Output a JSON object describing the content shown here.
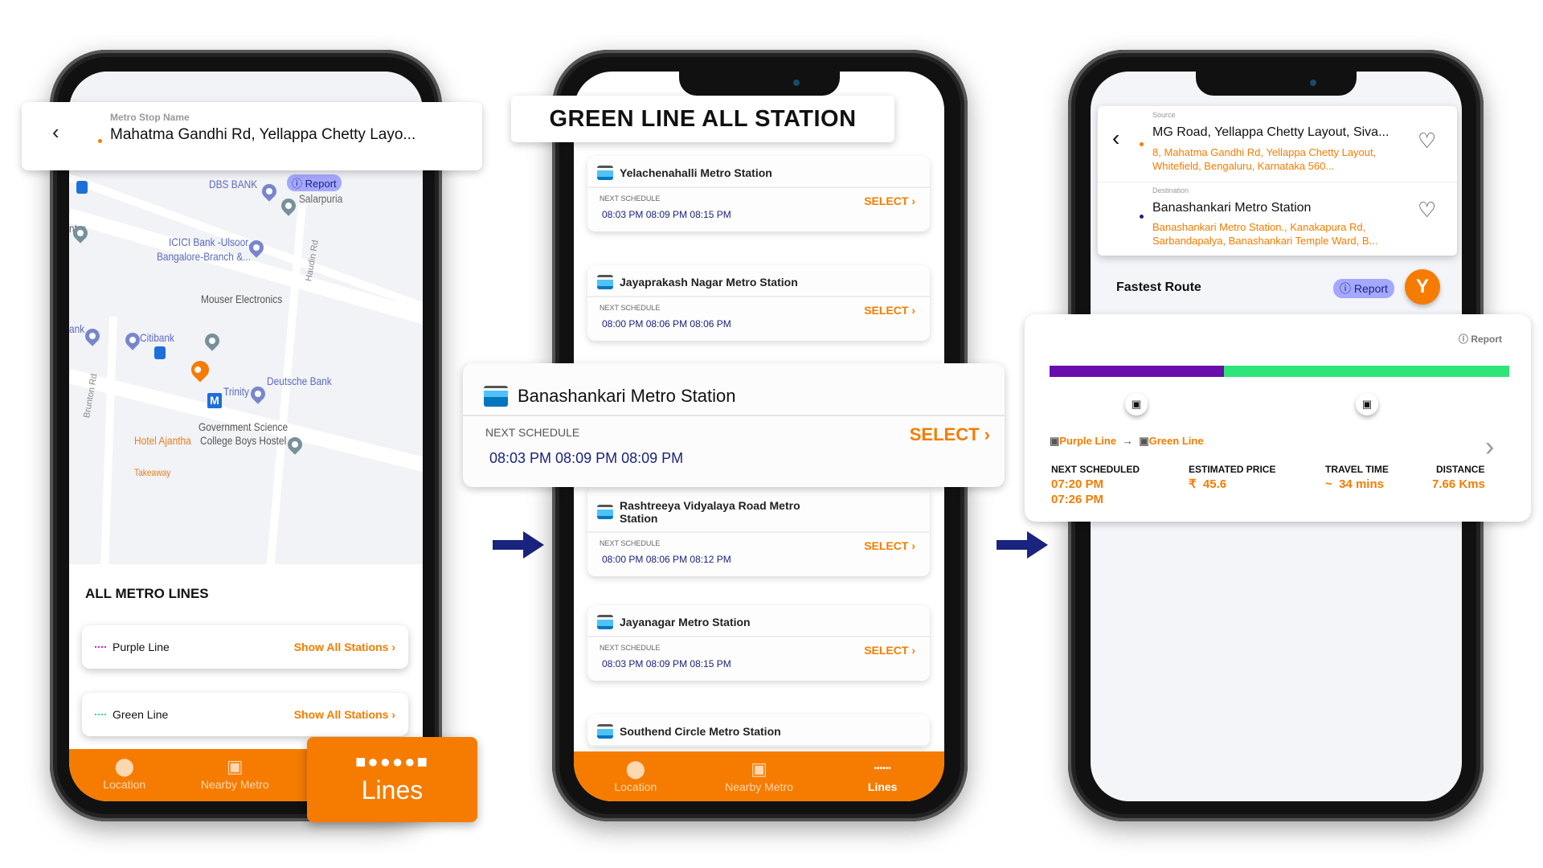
{
  "colors": {
    "accent": "#f57c00",
    "navy": "#1a237e",
    "purple_line": "#6a0dad",
    "green_line": "#2ee57a",
    "report_badge": "#a5a8ff"
  },
  "phone1": {
    "header": {
      "label": "Metro Stop Name",
      "value": "Mahatma Gandhi Rd, Yellappa Chetty Layo..."
    },
    "map": {
      "report": "Report",
      "labels": {
        "dbs": "DBS BANK",
        "salarpuria": "Salarpuria",
        "nter": "nter",
        "icici1": "ICICI Bank -Ulsoor,",
        "icici2": "Bangalore-Branch &...",
        "haudin": "Haudin Rd",
        "mouser": "Mouser Electronics",
        "ank": "ank",
        "citibank": "Citibank",
        "brunton": "Brunton Rd",
        "trinity": "Trinity",
        "metro": "M",
        "deutsche": "Deutsche Bank",
        "gov1": "Government Science",
        "gov2": "College Boys Hostel",
        "ajantha": "Hotel Ajantha",
        "takeaway": "Takeaway"
      }
    },
    "section_title": "ALL METRO LINES",
    "lines": [
      {
        "name": "Purple Line",
        "action": "Show All Stations",
        "color": "#d81bd8"
      },
      {
        "name": "Green Line",
        "action": "Show All Stations",
        "color": "#2ee57a"
      }
    ],
    "nav": [
      {
        "label": "Location",
        "icon": "location-pin-icon"
      },
      {
        "label": "Nearby Metro",
        "icon": "train-icon"
      }
    ],
    "callout": {
      "label": "Lines",
      "icon": "lines-dots-icon"
    }
  },
  "phone2": {
    "title": "GREEN LINE ALL STATION",
    "schedule_label": "NEXT SCHEDULE",
    "select_label": "SELECT",
    "stations": [
      {
        "name": "Yelachenahalli Metro Station",
        "times": "08:03 PM 08:09 PM 08:15 PM"
      },
      {
        "name": "Jayaprakash Nagar Metro Station",
        "times": "08:00 PM 08:06 PM 08:06 PM"
      },
      {
        "name": "Rashtreeya Vidyalaya Road Metro Station",
        "times": "08:00 PM 08:06 PM 08:12 PM"
      },
      {
        "name": "Jayanagar Metro Station",
        "times": "08:03 PM 08:09 PM 08:15 PM"
      },
      {
        "name": "Southend Circle Metro Station"
      }
    ],
    "highlight": {
      "name": "Banashankari Metro Station",
      "schedule_label": "NEXT SCHEDULE",
      "times": "08:03 PM 08:09 PM 08:09 PM",
      "select_label": "SELECT"
    },
    "nav": [
      {
        "label": "Location"
      },
      {
        "label": "Nearby Metro"
      },
      {
        "label": "Lines",
        "active": true
      }
    ]
  },
  "phone3": {
    "source": {
      "label": "Source",
      "title": "MG Road, Yellappa Chetty Layout, Siva...",
      "address": "8, Mahatma Gandhi Rd, Yellappa Chetty Layout, Whitefield, Bengaluru, Karnataka 560..."
    },
    "destination": {
      "label": "Destination",
      "title": "Banashankari Metro Station",
      "address": "Banashankari Metro Station., Kanakapura Rd, Sarbandapalya, Banashankari Temple Ward, B..."
    },
    "fastest_route": "Fastest Route",
    "report": "Report",
    "route": {
      "report": "Report",
      "purple_fraction": 0.38,
      "from_line": "Purple Line",
      "to_line": "Green Line",
      "stats": {
        "next_label": "NEXT SCHEDULED",
        "next1": "07:20 PM",
        "next2": "07:26 PM",
        "price_label": "ESTIMATED PRICE",
        "price": "₹  45.6",
        "time_label": "TRAVEL TIME",
        "time": "~  34 mins",
        "distance_label": "DISTANCE",
        "distance": "7.66 Kms"
      }
    }
  }
}
